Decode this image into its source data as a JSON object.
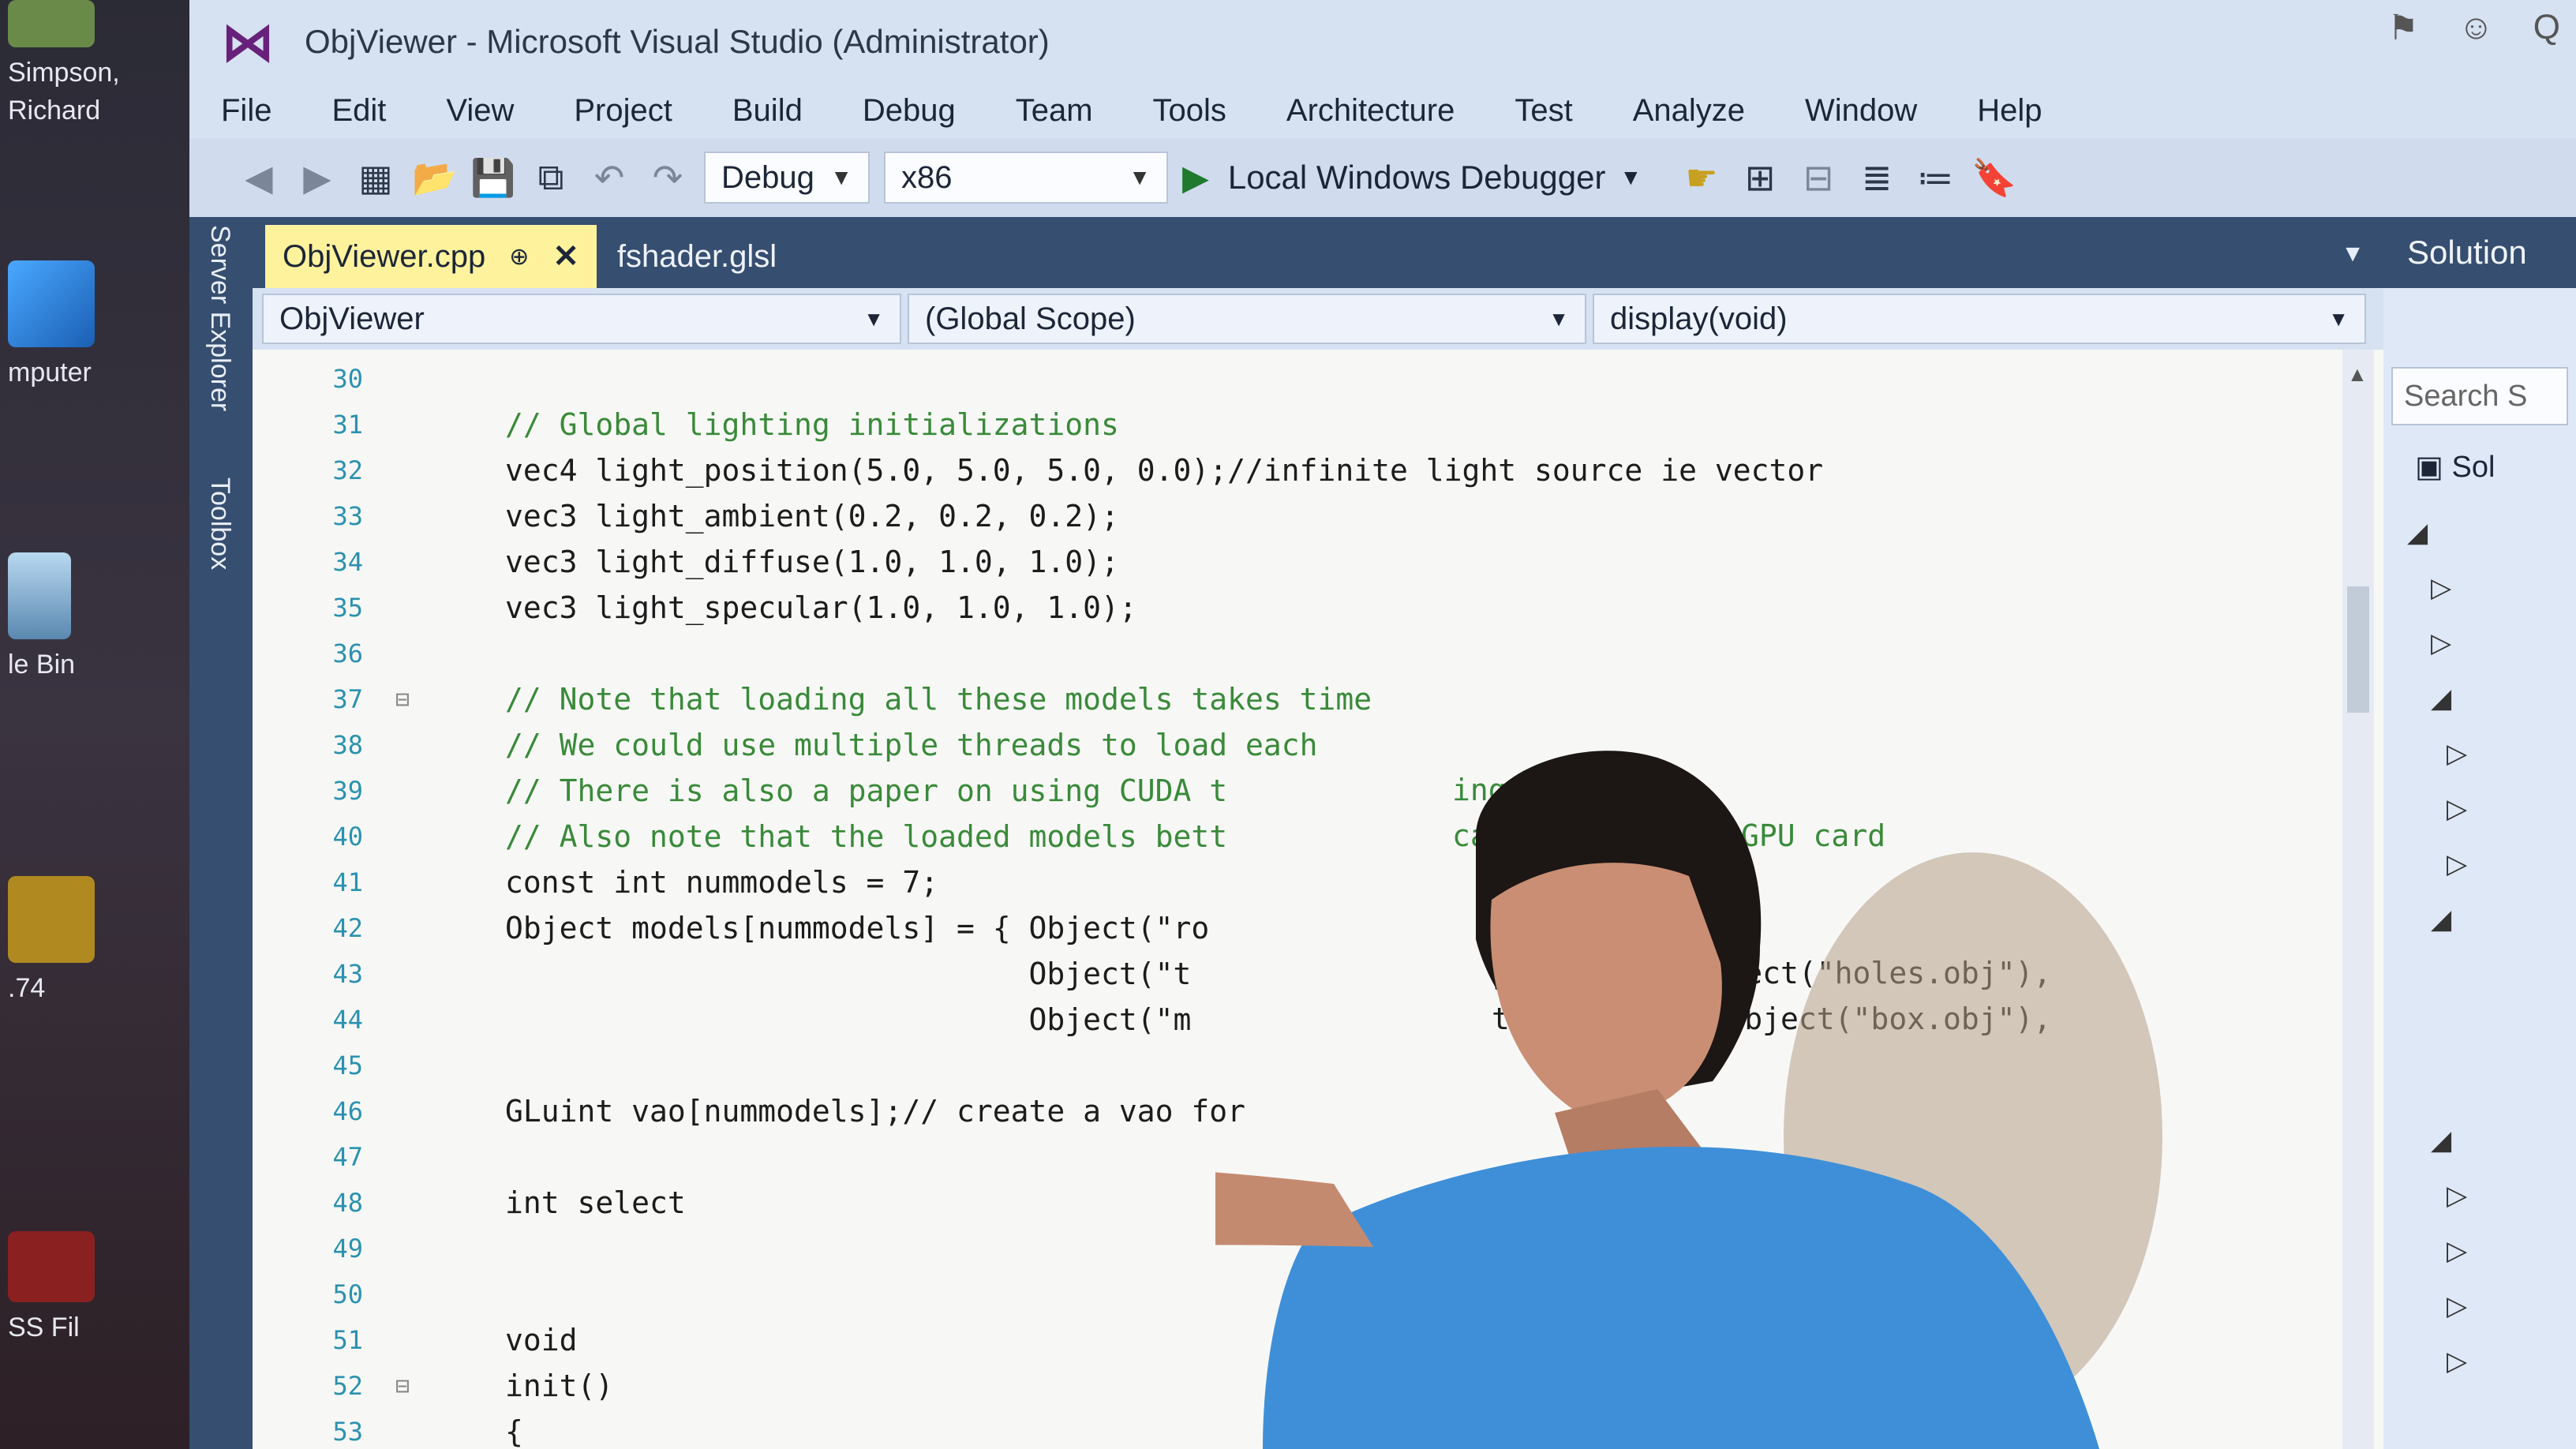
{
  "desktop": {
    "icons": [
      {
        "label": "Simpson, Richard",
        "icon": "user-folder-icon"
      },
      {
        "label": "mputer",
        "icon": "computer-icon"
      },
      {
        "label": "le Bin",
        "icon": "recycle-bin-icon"
      },
      {
        "label": ".74",
        "icon": "app-shortcut-icon"
      },
      {
        "label": "SS Fil",
        "icon": "file-shortcut-icon"
      }
    ]
  },
  "window": {
    "title": "ObjViewer - Microsoft Visual Studio (Administrator)",
    "quick_launch": "Q"
  },
  "menu": [
    "File",
    "Edit",
    "View",
    "Project",
    "Build",
    "Debug",
    "Team",
    "Tools",
    "Architecture",
    "Test",
    "Analyze",
    "Window",
    "Help"
  ],
  "toolbar": {
    "configuration": "Debug",
    "platform": "x86",
    "run_label": "Local Windows Debugger"
  },
  "side_tabs": [
    "Server Explorer",
    "Toolbox"
  ],
  "tabs": [
    {
      "label": "ObjViewer.cpp",
      "active": true
    },
    {
      "label": "fshader.glsl",
      "active": false
    }
  ],
  "navbar": {
    "project": "ObjViewer",
    "scope": "(Global Scope)",
    "member": "display(void)"
  },
  "code_lines": [
    {
      "n": "30",
      "text": "",
      "type": "plain"
    },
    {
      "n": "31",
      "text": "// Global lighting initializations",
      "type": "comment"
    },
    {
      "n": "32",
      "text": "vec4 light_position(5.0, 5.0, 5.0, 0.0);//infinite light source ie vector",
      "type": "plain"
    },
    {
      "n": "33",
      "text": "vec3 light_ambient(0.2, 0.2, 0.2);",
      "type": "plain"
    },
    {
      "n": "34",
      "text": "vec3 light_diffuse(1.0, 1.0, 1.0);",
      "type": "plain"
    },
    {
      "n": "35",
      "text": "vec3 light_specular(1.0, 1.0, 1.0);",
      "type": "plain"
    },
    {
      "n": "36",
      "text": "",
      "type": "plain"
    },
    {
      "n": "37",
      "text": "// Note that loading all these models takes time",
      "type": "comment"
    },
    {
      "n": "38",
      "text": "// We could use multiple threads to load each",
      "type": "comment"
    },
    {
      "n": "39",
      "text": "// There is also a paper on using CUDA t",
      "type": "comment"
    },
    {
      "n": "40",
      "text": "// Also note that the loaded models bett",
      "type": "comment"
    },
    {
      "n": "41",
      "text": "const int nummodels = 7;",
      "type": "plain"
    },
    {
      "n": "42",
      "text": "Object models[nummodels] = { Object(\"ro",
      "type": "plain"
    },
    {
      "n": "43",
      "text": "                             Object(\"t",
      "type": "plain"
    },
    {
      "n": "44",
      "text": "                             Object(\"m",
      "type": "plain"
    },
    {
      "n": "45",
      "text": "",
      "type": "plain"
    },
    {
      "n": "46",
      "text": "GLuint vao[nummodels];// create a vao for",
      "type": "plain"
    },
    {
      "n": "47",
      "text": "",
      "type": "plain"
    },
    {
      "n": "48",
      "text": "int select",
      "type": "plain"
    },
    {
      "n": "49",
      "text": "",
      "type": "plain"
    },
    {
      "n": "50",
      "text": "",
      "type": "plain"
    },
    {
      "n": "51",
      "text": "void",
      "type": "plain"
    },
    {
      "n": "52",
      "text": "init()",
      "type": "plain"
    },
    {
      "n": "53",
      "text": "{",
      "type": "plain"
    }
  ],
  "code_fragments_right": [
    {
      "text": "ing",
      "line": "39"
    },
    {
      "text": "capacity of the GPU card",
      "line": "40"
    },
    {
      "text": "gy2.obj\"), Object(\"holes.obj\"),",
      "line": "43"
    },
    {
      "text": "t8all.obj\"), Object(\"box.obj\"),",
      "line": "44"
    }
  ],
  "solution_explorer": {
    "header": "Solution",
    "search_placeholder": "Search S",
    "root_item": "Sol"
  }
}
